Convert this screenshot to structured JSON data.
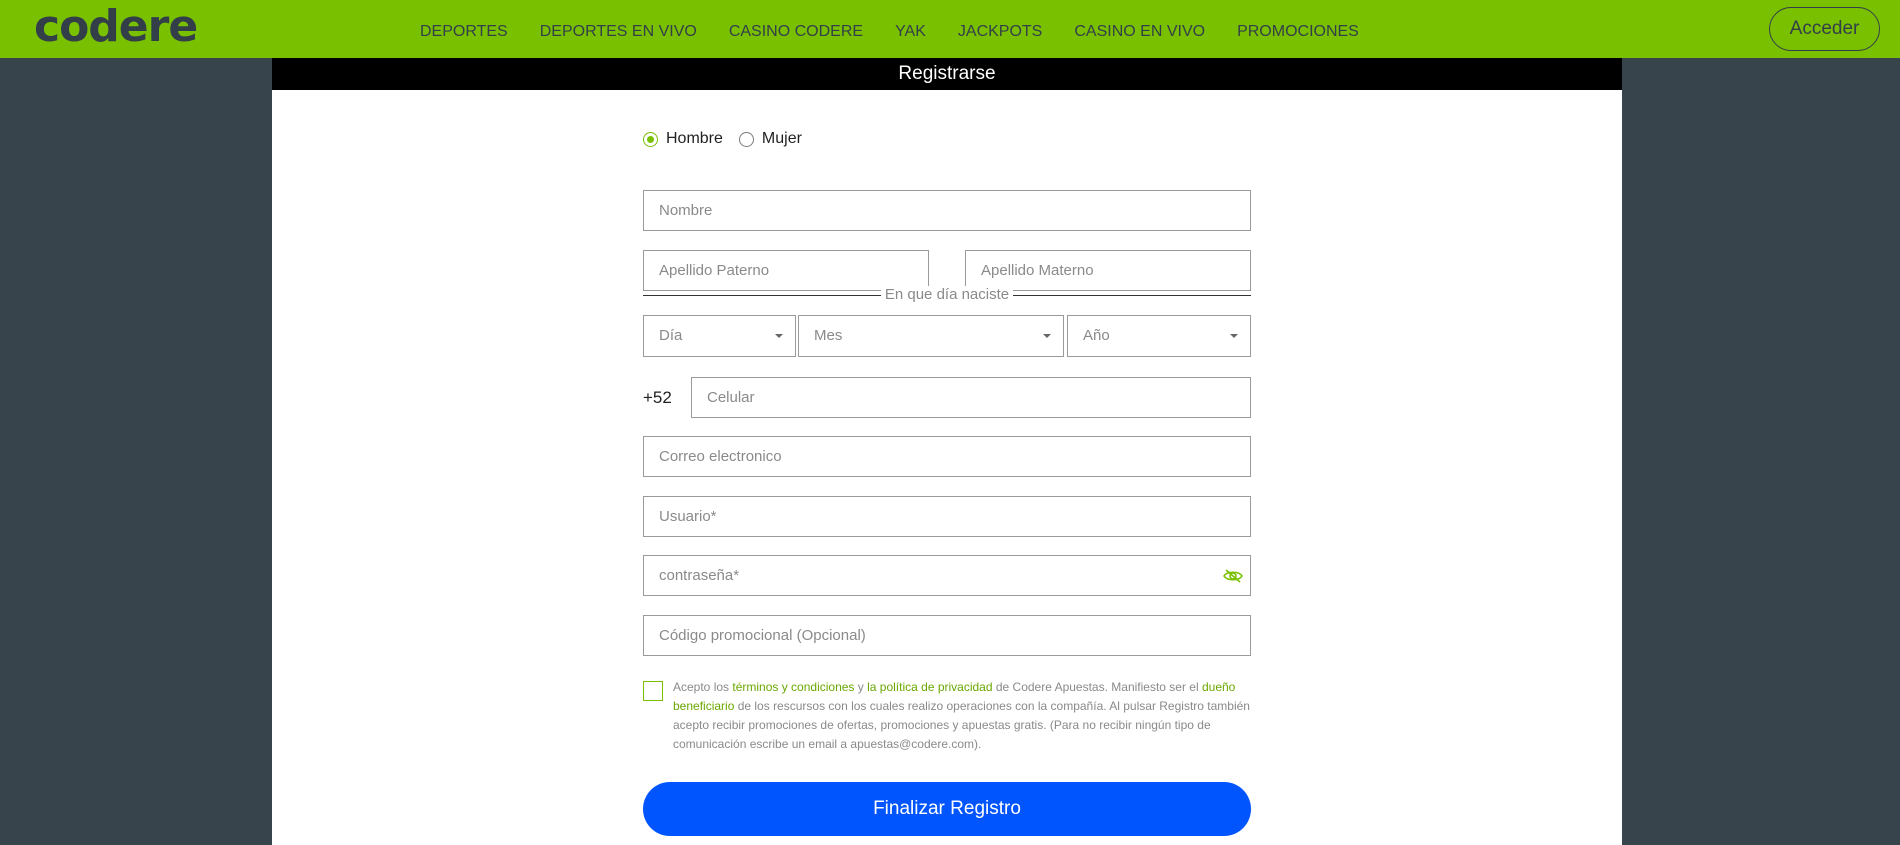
{
  "header": {
    "logo": "codere",
    "nav": [
      "DEPORTES",
      "DEPORTES EN VIVO",
      "CASINO CODERE",
      "YAK",
      "JACKPOTS",
      "CASINO EN VIVO",
      "PROMOCIONES"
    ],
    "login_label": "Acceder"
  },
  "panel": {
    "title": "Registrarse"
  },
  "form": {
    "gender": {
      "male": "Hombre",
      "female": "Mujer",
      "selected": "Hombre"
    },
    "nombre_placeholder": "Nombre",
    "apellido_paterno_placeholder": "Apellido Paterno",
    "apellido_materno_placeholder": "Apellido Materno",
    "birth_label": "En que día naciste",
    "day_label": "Día",
    "month_label": "Mes",
    "year_label": "Año",
    "phone_prefix": "+52",
    "phone_placeholder": "Celular",
    "email_placeholder": "Correo electronico",
    "user_placeholder": "Usuario*",
    "password_placeholder": "contraseña*",
    "promo_placeholder": "Código promocional (Opcional)",
    "legal": {
      "t1": "Acepto los ",
      "terms_link": "términos y condiciones",
      "t2": " y ",
      "privacy_link": "la política de privacidad",
      "t3": " de Codere Apuestas. Manifiesto ser el ",
      "owner_link": "dueño beneficiario",
      "t4": " de los rescursos con los cuales realizo operaciones con la compañía. Al pulsar Registro también acepto recibir promociones de ofertas, promociones y apuestas gratis. (Para no recibir ningún tipo de comunicación escribe un email a apuestas@codere.com)."
    },
    "submit_label": "Finalizar Registro"
  },
  "colors": {
    "brand_green": "#79c000",
    "header_text": "#333f48",
    "submit_blue": "#0055ff",
    "page_bg": "#37444b"
  }
}
